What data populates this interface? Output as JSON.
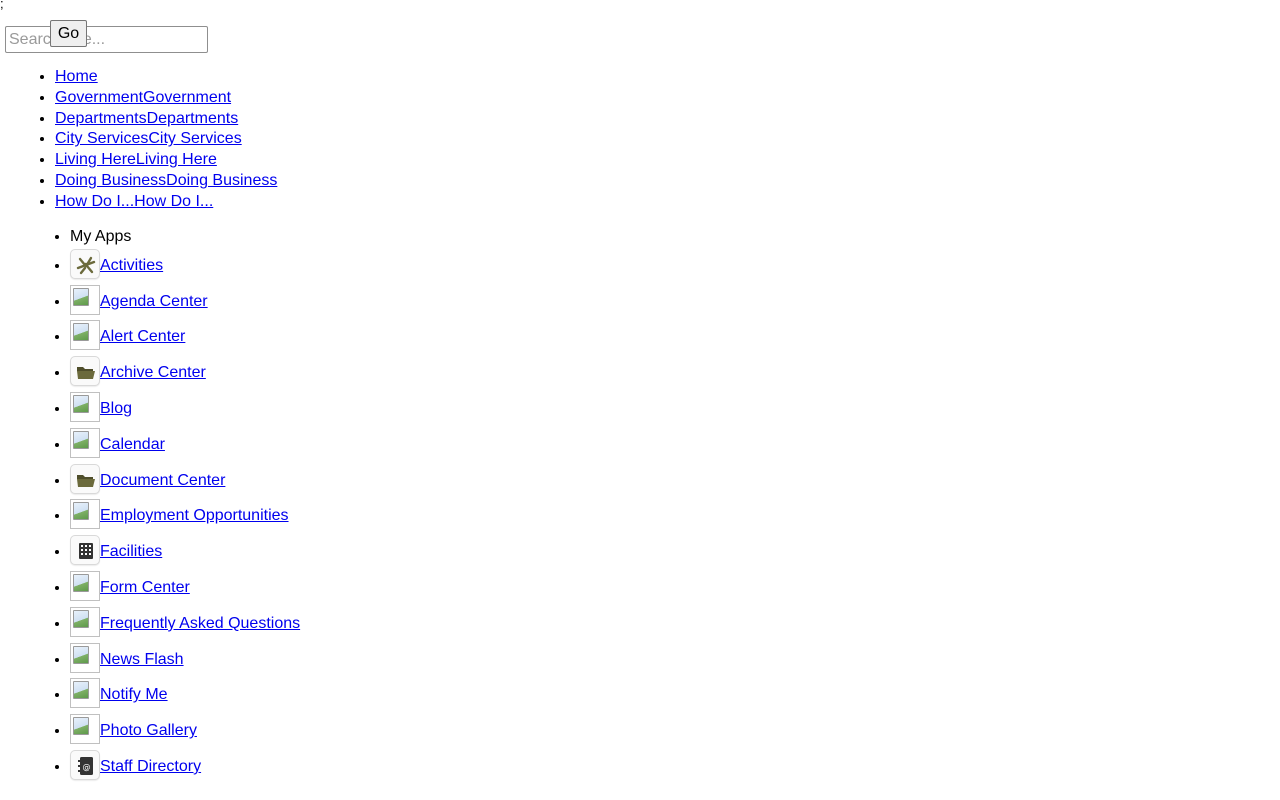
{
  "stray_text": ";",
  "search": {
    "placeholder": "Search Site...",
    "button_label": "Go"
  },
  "main_nav": [
    {
      "label": "Home"
    },
    {
      "label": "GovernmentGovernment"
    },
    {
      "label": "DepartmentsDepartments"
    },
    {
      "label": "City ServicesCity Services"
    },
    {
      "label": "Living HereLiving Here"
    },
    {
      "label": "Doing BusinessDoing Business"
    },
    {
      "label": "How Do I...How Do I..."
    }
  ],
  "apps": {
    "header": "My Apps",
    "items": [
      {
        "label": "Activities",
        "icon": "activities-icon"
      },
      {
        "label": "Agenda Center",
        "icon": "broken-image-icon"
      },
      {
        "label": "Alert Center",
        "icon": "broken-image-icon"
      },
      {
        "label": "Archive Center",
        "icon": "folder-icon"
      },
      {
        "label": "Blog",
        "icon": "broken-image-icon"
      },
      {
        "label": "Calendar",
        "icon": "broken-image-icon"
      },
      {
        "label": "Document Center",
        "icon": "folder-icon"
      },
      {
        "label": "Employment Opportunities",
        "icon": "broken-image-icon"
      },
      {
        "label": "Facilities",
        "icon": "building-icon"
      },
      {
        "label": "Form Center",
        "icon": "broken-image-icon"
      },
      {
        "label": "Frequently Asked Questions",
        "icon": "broken-image-icon"
      },
      {
        "label": "News Flash",
        "icon": "broken-image-icon"
      },
      {
        "label": "Notify Me",
        "icon": "broken-image-icon"
      },
      {
        "label": "Photo Gallery",
        "icon": "broken-image-icon"
      },
      {
        "label": "Staff Directory",
        "icon": "address-book-icon"
      }
    ]
  },
  "colors": {
    "link": "#0000ee",
    "icon_olive": "#6b6a3c",
    "icon_dark": "#333333"
  }
}
